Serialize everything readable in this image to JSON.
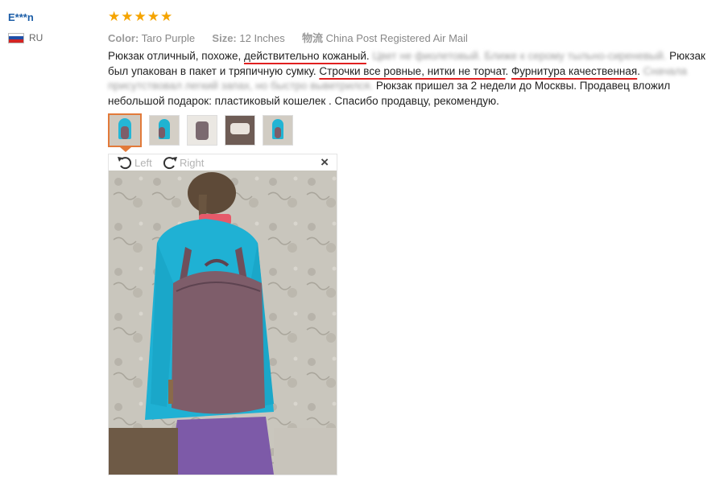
{
  "reviewer": {
    "name": "E***n",
    "country": "RU"
  },
  "rating": {
    "stars": 5,
    "stars_text": "★★★★★"
  },
  "attributes": {
    "color_label": "Color:",
    "color_value": "Taro Purple",
    "size_label": "Size:",
    "size_value": "12 Inches",
    "shipping_label": "物流",
    "shipping_value": "China Post Registered Air Mail"
  },
  "review": {
    "p1": "Рюкзак отличный, похоже, ",
    "u1": "действительно кожаный",
    "p2": ". ",
    "b1": "Цвет не фиолетовый. Ближе к серому тыльно-сиреневый.",
    "p3": " Рюкзак был упакован в пакет и тряпичную сумку. ",
    "u2": "Строчки все ровные, нитки не торчат",
    "p4": ". ",
    "u3": "Фурнитура качественная",
    "p5": ". ",
    "b2": "Сначала присутствовал легкий запах, но быстро выветрился.",
    "p6": " Рюкзак пришел за 2 недели до Москвы. Продавец вложил небольшой подарок: пластиковый кошелек . Спасибо продавцу, рекомендую."
  },
  "viewer": {
    "rotate_left_label": "Left",
    "rotate_right_label": "Right",
    "close_icon": "×"
  },
  "colors": {
    "username": "#1e5fa8",
    "stars": "#f5a400",
    "underline": "#e02020",
    "selected_thumb": "#e27a3a"
  },
  "icons": [
    "flag-ru-icon",
    "star-icon",
    "rotate-left-icon",
    "rotate-right-icon",
    "close-icon"
  ]
}
